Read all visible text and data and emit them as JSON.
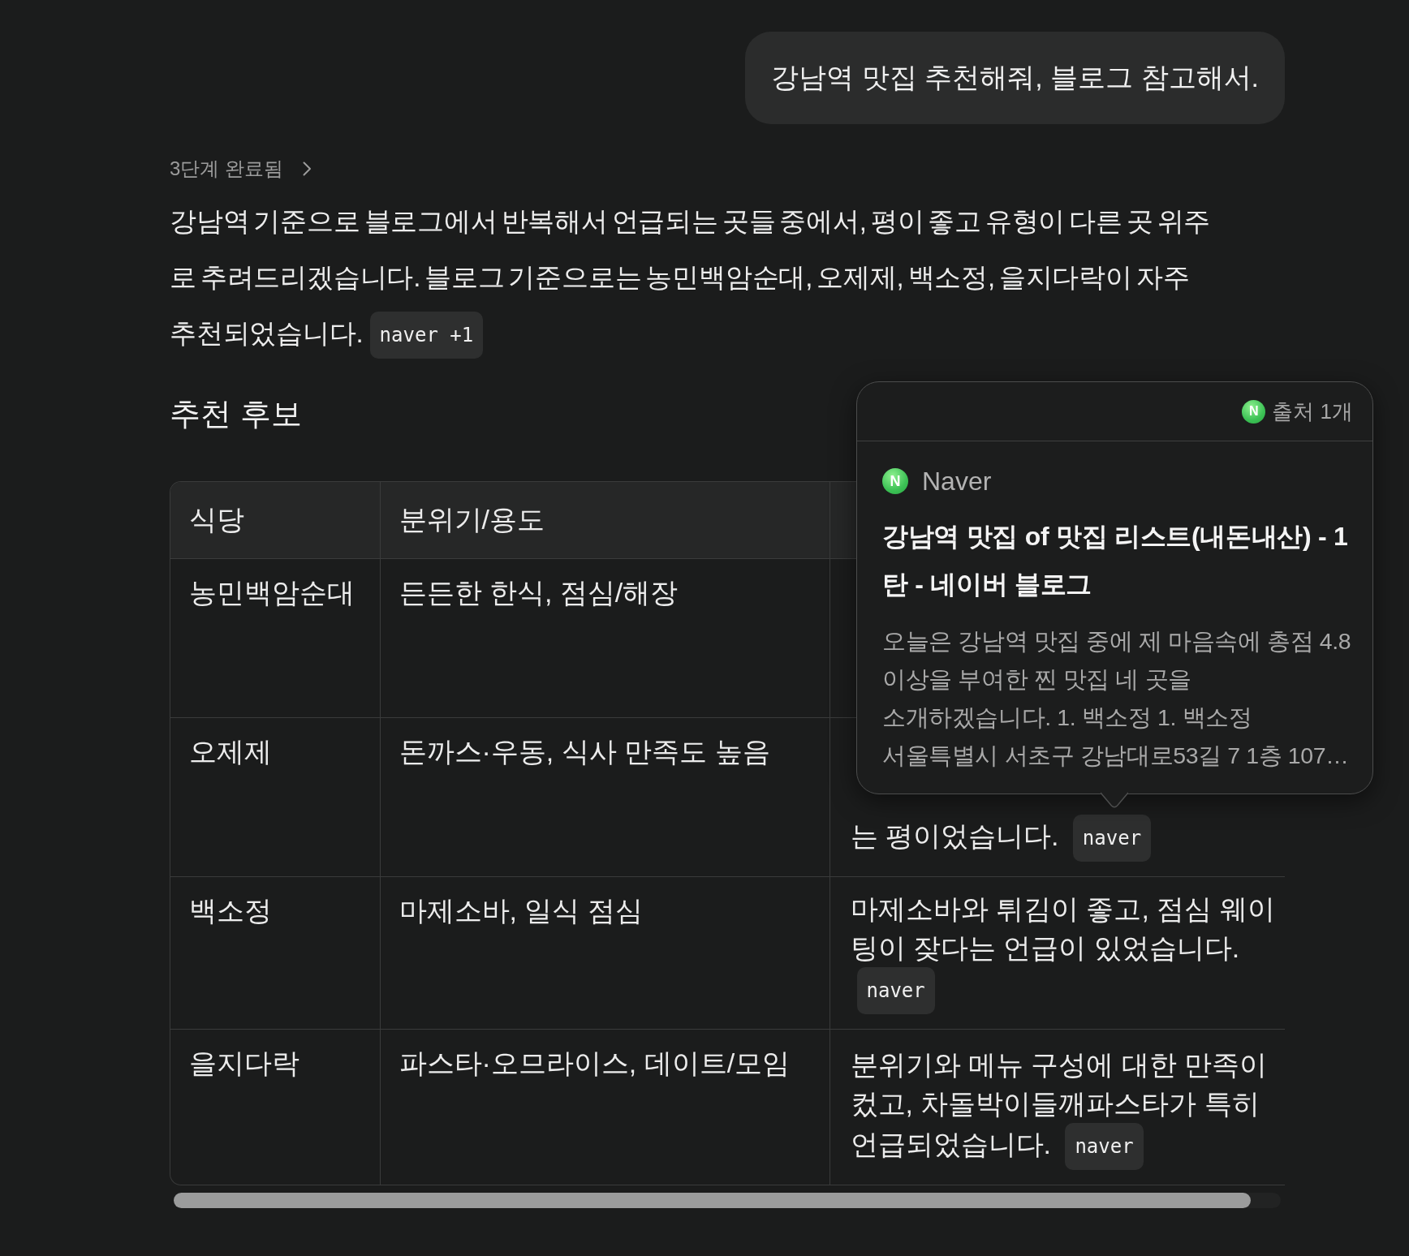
{
  "user_message": {
    "text": "강남역 맛집 추천해줘, 블로그 참고해서."
  },
  "steps_toggle": {
    "label": "3단계 완료됨",
    "expanded": false
  },
  "answer": {
    "text": "강남역 기준으로 블로그에서 반복해서 언급되는 곳들 중에서, 평이 좋고 유형이 다른 곳 위주로 추려드리겠습니다. 블로그 기준으로는 농민백암순대, 오제제, 백소정, 을지다락이 자주 추천되었습니다.",
    "citation": "naver +1"
  },
  "section_heading": "추천 후보",
  "table": {
    "columns": [
      "식당",
      "분위기/용도"
    ],
    "rows": [
      {
        "restaurant": "농민백암순대",
        "use": "든든한 한식, 점심/해장"
      },
      {
        "restaurant": "오제제",
        "use": "돈까스·우동, 식사 만족도 높음",
        "note": {
          "text": "는 평이었습니다.",
          "citation": "naver"
        }
      },
      {
        "restaurant": "백소정",
        "use": "마제소바, 일식 점심",
        "note": {
          "text": "마제소바와 튀김이 좋고, 점심 웨이팅이 잦다는 언급이 있었습니다.",
          "citation": "naver"
        }
      },
      {
        "restaurant": "을지다락",
        "use": "파스타·오므라이스, 데이트/모임",
        "note": {
          "text": "분위기와 메뉴 구성에 대한 만족이 컸고, 차돌박이들깨파스타가 특히 언급되었습니다.",
          "citation": "naver"
        }
      }
    ]
  },
  "popover": {
    "logo_letter": "N",
    "count_label": "출처 1개",
    "source": {
      "logo_letter": "N",
      "name": "Naver",
      "title": "강남역 맛집 of 맛집 리스트(내돈내산) - 1탄 - 네이버 블로그",
      "snippet": "오늘은 강남역 맛집 중에 제 마음속에 총점 4.8 이상을 부여한 찐 맛집 네 곳을 소개하겠습니다. 1. 백소정 1. 백소정 서울특별시 서초구 강남대로53길 7 1층 107…"
    }
  }
}
